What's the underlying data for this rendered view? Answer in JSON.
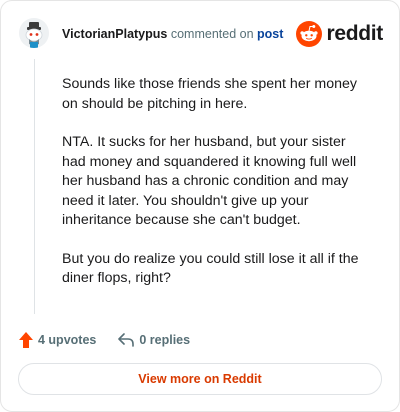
{
  "header": {
    "username": "VictorianPlatypus",
    "action_text": "commented on",
    "post_link": "post",
    "brand": "reddit",
    "avatar_icon": "snoo-avatar-icon",
    "logo_icon": "reddit-snoo-icon"
  },
  "comment": {
    "paragraphs": [
      "Sounds like those friends she spent her money on should be pitching in here.",
      "NTA. It sucks for her husband, but your sister had money and squandered it knowing full well her husband has a chronic condition and may need it later. You shouldn't give up your inheritance because she can't budget.",
      "But you do realize you could still lose it all if the diner flops, right?"
    ]
  },
  "actions": {
    "upvotes": "4 upvotes",
    "replies": "0 replies",
    "upvote_icon": "upvote-arrow-icon",
    "reply_icon": "reply-arrow-icon"
  },
  "footer": {
    "view_more": "View more on Reddit"
  },
  "colors": {
    "brand_orange": "#ff4500",
    "link_blue": "#0a449b",
    "cta_orange": "#d93a00",
    "muted": "#576f76"
  }
}
